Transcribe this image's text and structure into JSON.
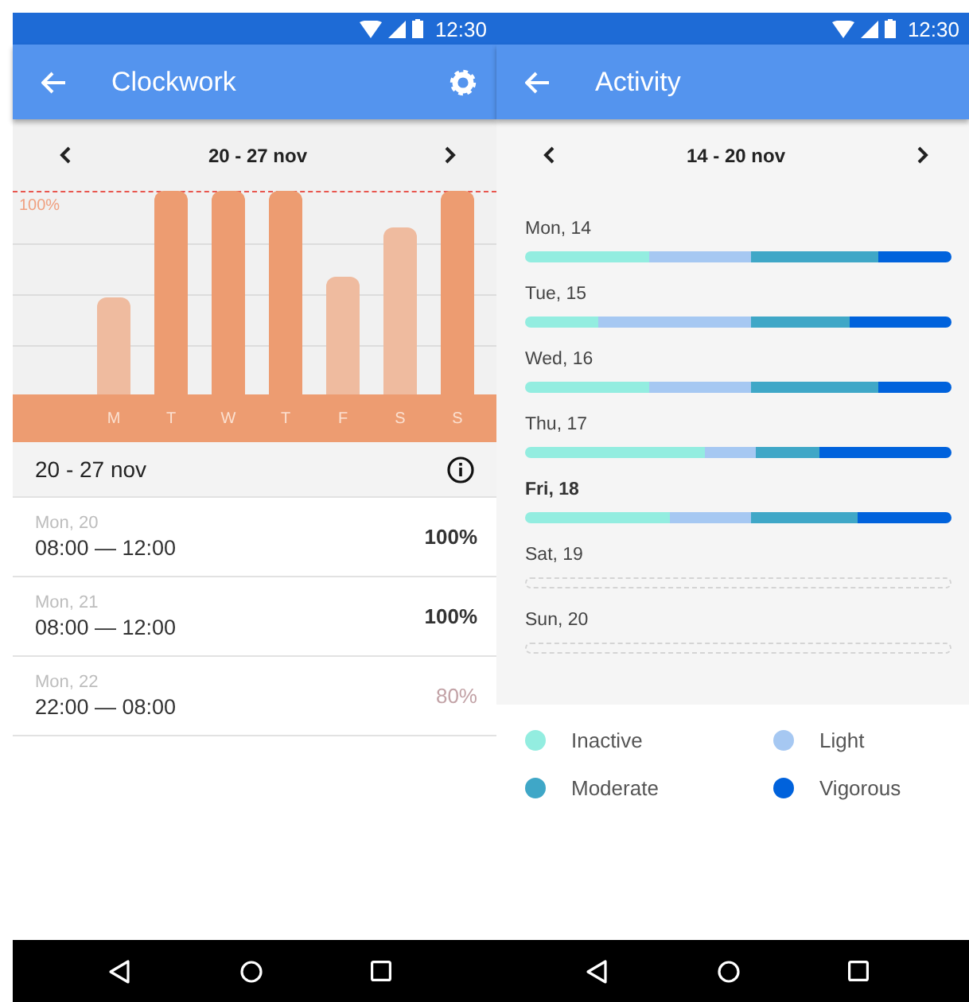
{
  "clockwork_screen": {
    "status_bar": {
      "time": "12:30"
    },
    "app_bar": {
      "title": "Clockwork"
    },
    "week_nav": {
      "label": "20 - 27 nov"
    },
    "chart": {
      "max_label": "100%",
      "days": [
        {
          "label": "M",
          "reached": false
        },
        {
          "label": "T",
          "reached": true
        },
        {
          "label": "W",
          "reached": true
        },
        {
          "label": "T",
          "reached": true
        },
        {
          "label": "F",
          "reached": false
        },
        {
          "label": "S",
          "reached": false
        },
        {
          "label": "S",
          "reached": true
        }
      ]
    },
    "summary": {
      "title": "20 - 27 nov"
    },
    "entries": [
      {
        "date": "Mon, 20",
        "time": "08:00 — 12:00",
        "percent": "100%",
        "complete": true
      },
      {
        "date": "Mon, 21",
        "time": "08:00 — 12:00",
        "percent": "100%",
        "complete": true
      },
      {
        "date": "Mon, 22",
        "time": "22:00 — 08:00",
        "percent": "80%",
        "complete": false
      }
    ]
  },
  "activity_screen": {
    "status_bar": {
      "time": "12:30"
    },
    "app_bar": {
      "title": "Activity"
    },
    "week_nav": {
      "label": "14 - 20 nov"
    },
    "days": [
      {
        "label": "Mon, 14",
        "today": false,
        "has_data": true
      },
      {
        "label": "Tue, 15",
        "today": false,
        "has_data": true
      },
      {
        "label": "Wed, 16",
        "today": false,
        "has_data": true
      },
      {
        "label": "Thu, 17",
        "today": false,
        "has_data": true
      },
      {
        "label": "Fri, 18",
        "today": true,
        "has_data": true
      },
      {
        "label": "Sat, 19",
        "today": false,
        "has_data": false
      },
      {
        "label": "Sun, 20",
        "today": false,
        "has_data": false
      }
    ],
    "legend": [
      {
        "label": "Inactive",
        "color": "#93ede0"
      },
      {
        "label": "Light",
        "color": "#a6c8f2"
      },
      {
        "label": "Moderate",
        "color": "#3fa7c7"
      },
      {
        "label": "Vigorous",
        "color": "#0062dc"
      }
    ]
  }
}
